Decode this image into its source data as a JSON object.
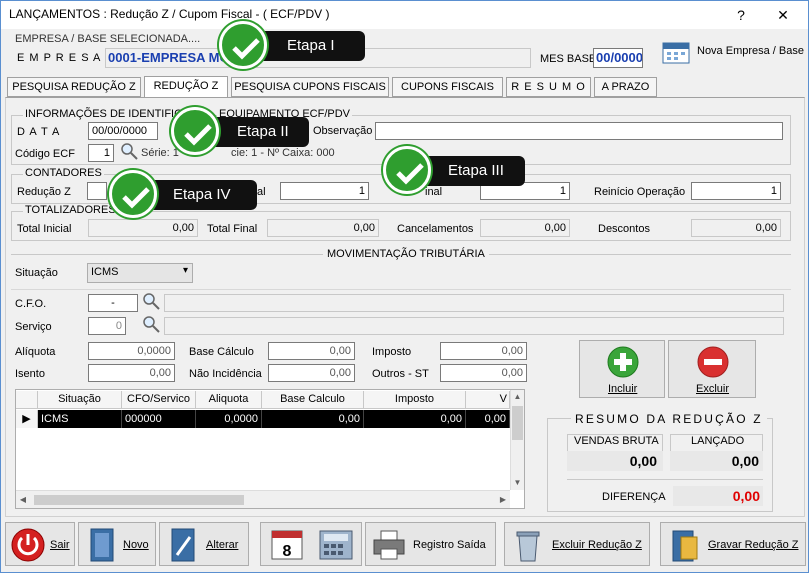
{
  "window": {
    "title": "LANÇAMENTOS : Redução Z / Cupom Fiscal - ( ECF/PDV )",
    "help": "?",
    "close": "✕"
  },
  "empresa": {
    "group_title": "EMPRESA / BASE SELECIONADA....",
    "label": "E M P R E S A",
    "value": "0001-EMPRESA MO",
    "mes_base_label": "MES BASE",
    "mes_base_value": "00/0000",
    "nova_button": "Nova Empresa / Base"
  },
  "tabs": [
    "PESQUISA REDUÇÃO Z",
    "REDUÇÃO Z",
    "PESQUISA CUPONS FISCAIS",
    "CUPONS FISCAIS",
    "R E S U M O",
    "A PRAZO"
  ],
  "info": {
    "group_title": "INFORMAÇÕES DE IDENTIFICA",
    "group_title_rest": "EQUIPAMENTO ECF/PDV",
    "data_label": "D A T A",
    "data_value": "00/00/0000",
    "observacao_label": "Observação",
    "observacao_value": "",
    "codigo_label": "Código ECF",
    "codigo_value": "1",
    "serie_text": "Série: 1",
    "caixa_text": "cie: 1 -   Nº Caixa: 000"
  },
  "contadores": {
    "group_title": "CONTADORES",
    "reducao_label": "Redução Z",
    "field2_label": "al",
    "field2_value": "1",
    "field3_label": "inal",
    "field3_value": "1",
    "reinicio_label": "Reinício Operação",
    "reinicio_value": "1"
  },
  "totalizadores": {
    "group_title": "TOTALIZADORES",
    "total_inicial_label": "Total Inicial",
    "total_inicial_value": "0,00",
    "total_final_label": "Total Final",
    "total_final_value": "0,00",
    "cancelamentos_label": "Cancelamentos",
    "cancelamentos_value": "0,00",
    "descontos_label": "Descontos",
    "descontos_value": "0,00"
  },
  "movimentacao": {
    "title": "MOVIMENTAÇÃO TRIBUTÁRIA",
    "situacao_label": "Situação",
    "situacao_value": "ICMS",
    "cfo_label": "C.F.O.",
    "cfo_value": "-",
    "servico_label": "Serviço",
    "servico_value": "0",
    "aliquota_label": "Alíquota",
    "aliquota_value": "0,0000",
    "base_label": "Base Cálculo",
    "base_value": "0,00",
    "imposto_label": "Imposto",
    "imposto_value": "0,00",
    "isento_label": "Isento",
    "isento_value": "0,00",
    "nao_incid_label": "Não Incidência",
    "nao_incid_value": "0,00",
    "outros_label": "Outros - ST",
    "outros_value": "0,00",
    "incluir": "Incluir",
    "excluir": "Excluir"
  },
  "grid": {
    "headers": [
      "Situação",
      "CFO/Servico",
      "Aliquota",
      "Base Calculo",
      "Imposto",
      "V"
    ],
    "row": [
      "ICMS",
      "000000",
      "0,0000",
      "0,00",
      "0,00",
      "0,00"
    ]
  },
  "resumo": {
    "title": "RESUMO DA REDUÇÃO Z",
    "vendas_label": "VENDAS BRUTA",
    "vendas_value": "0,00",
    "lancado_label": "LANÇADO",
    "lancado_value": "0,00",
    "diferenca_label": "DIFERENÇA",
    "diferenca_value": "0,00"
  },
  "toolbar": {
    "sair": "Sair",
    "novo": "Novo",
    "alterar": "Alterar",
    "registro": "Registro Saída",
    "excluir_reducao": "Excluir Redução Z",
    "gravar": "Gravar Redução Z"
  },
  "callouts": {
    "etapa1": "Etapa I",
    "etapa2": "Etapa II",
    "etapa3": "Etapa III",
    "etapa4": "Etapa IV"
  },
  "colors": {
    "accent_blue": "#1a3fb0",
    "red": "#e00000",
    "callout_bg": "#111111",
    "check_green": "#2f9e2f"
  }
}
